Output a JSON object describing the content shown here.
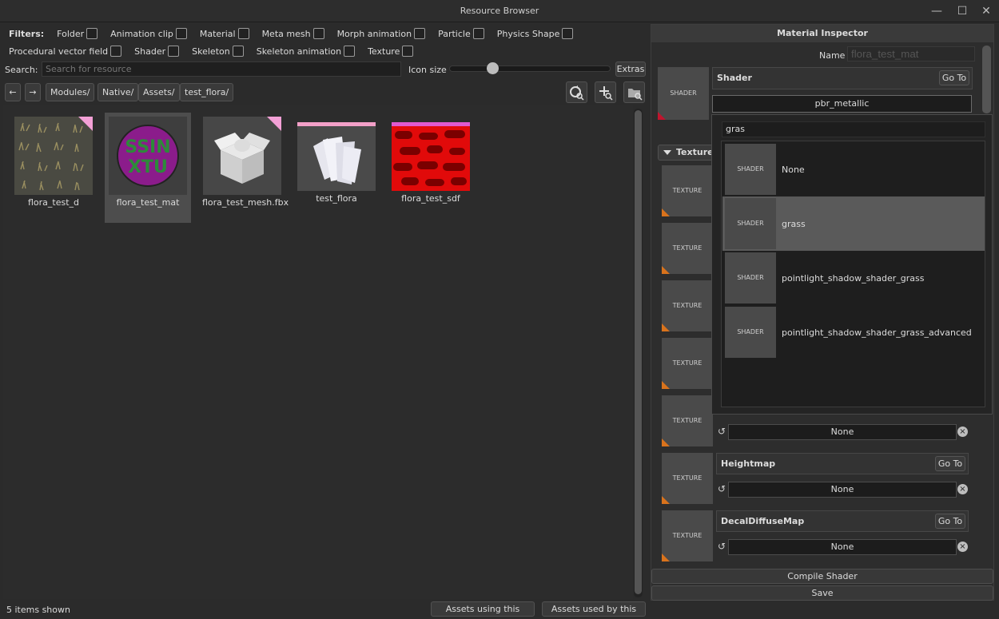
{
  "window": {
    "title": "Resource Browser",
    "minimize_icon": "minimize-icon",
    "maximize_icon": "maximize-icon",
    "close_icon": "close-icon"
  },
  "filters": {
    "label": "Filters:",
    "row1": [
      "Folder",
      "Animation clip",
      "Material",
      "Meta mesh",
      "Morph animation",
      "Particle",
      "Physics Shape"
    ],
    "row2": [
      "Procedural vector field",
      "Shader",
      "Skeleton",
      "Skeleton animation",
      "Texture"
    ]
  },
  "search": {
    "label": "Search:",
    "placeholder": "Search for resource",
    "icon_size_label": "Icon size",
    "icon_size_value": 0.25,
    "extras_label": "Extras"
  },
  "nav": {
    "back_icon": "arrow-left-icon",
    "forward_icon": "arrow-right-icon",
    "breadcrumb": [
      "Modules/",
      "Native/",
      "Assets/",
      "test_flora/"
    ],
    "tools": [
      "refresh-search-icon",
      "add-zoom-icon",
      "folder-image-icon"
    ]
  },
  "assets": [
    {
      "name": "flora_test_d",
      "kind": "texture"
    },
    {
      "name": "flora_test_mat",
      "kind": "material",
      "selected": true
    },
    {
      "name": "flora_test_mesh.fbx",
      "kind": "mesh"
    },
    {
      "name": "test_flora",
      "kind": "flora"
    },
    {
      "name": "flora_test_sdf",
      "kind": "sdf"
    }
  ],
  "status": {
    "items_shown": "5 items shown",
    "assets_using": "Assets using this",
    "assets_used_by": "Assets used by this"
  },
  "inspector": {
    "title": "Material Inspector",
    "name_label": "Name",
    "name_value": "flora_test_mat",
    "shader_tile": "SHADER",
    "shader_header": "Shader",
    "goto_label": "Go To",
    "shader_value": "pbr_metallic",
    "textures_section": "Textures",
    "texture_tile": "TEXTURE",
    "slots": [
      {
        "name": "",
        "value": "None"
      },
      {
        "name": "Heightmap",
        "value": "None"
      },
      {
        "name": "DecalDiffuseMap",
        "value": "None"
      }
    ],
    "compile_label": "Compile Shader",
    "save_label": "Save"
  },
  "dropdown": {
    "query": "gras",
    "tile_label": "SHADER",
    "items": [
      "None",
      "grass",
      "pointlight_shadow_shader_grass",
      "pointlight_shadow_shader_grass_advanced"
    ],
    "selected_index": 1
  },
  "colors": {
    "accent_orange": "#d9731c",
    "accent_red": "#c0152e",
    "corner_pink": "#f3a0d6"
  }
}
